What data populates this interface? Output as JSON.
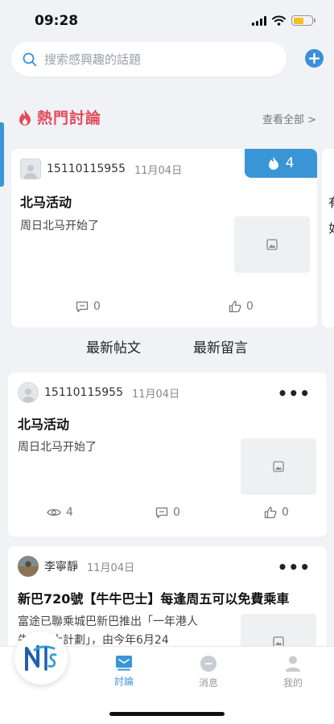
{
  "status_bar": {
    "time": "09:28"
  },
  "search": {
    "placeholder": "搜索感興趣的話題"
  },
  "hot": {
    "title": "熱門討論",
    "see_all": "查看全部",
    "see_all_arrow": ">",
    "card": {
      "username": "15110115955",
      "date": "11月04日",
      "title": "北马活动",
      "body": "周日北马开始了",
      "badge_count": "4",
      "comments": "0",
      "likes": "0"
    },
    "next_card_chars": [
      "有",
      "如"
    ]
  },
  "tabs": {
    "latest_posts": "最新帖文",
    "latest_comments": "最新留言"
  },
  "posts": [
    {
      "username": "15110115955",
      "date": "11月04日",
      "title": "北马活动",
      "body": "周日北马开始了",
      "views": "4",
      "comments": "0",
      "likes": "0"
    },
    {
      "username": "李寧靜",
      "date": "11月04日",
      "title": "新巴720號【牛牛巴士】每逢周五可以免費乘車",
      "body_line1": "富途已聯乘城巴新巴推出「一年港人",
      "body_line2": "牛牛巴士計劃」，由今年6月24"
    }
  ],
  "more_label": "•••",
  "bottom_nav": {
    "discuss": "討論",
    "messages": "消息",
    "mine": "我的"
  },
  "colors": {
    "accent": "#3a95d6",
    "hot_red": "#e24b5b"
  }
}
